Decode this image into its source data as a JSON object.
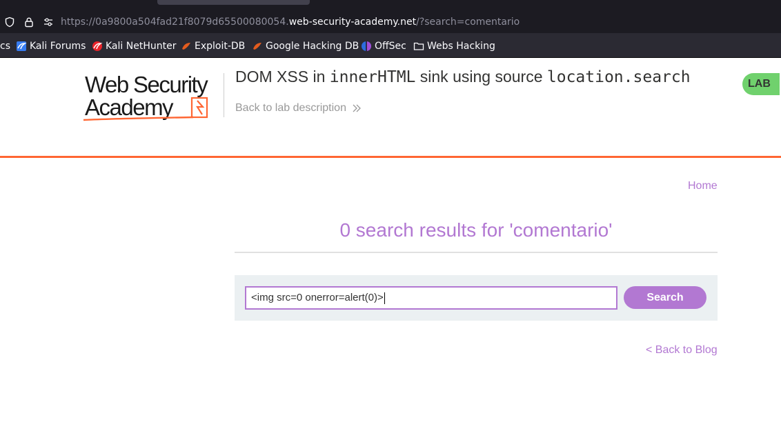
{
  "browser": {
    "url_prefix": "https://0a9800a504fad21f8079d65500080054.",
    "url_host": "web-security-academy.net",
    "url_suffix": "/?search=comentario",
    "bookmarks": [
      {
        "label": "cs",
        "icon": "truncated-icon"
      },
      {
        "label": "Kali Forums",
        "icon": "kali-forums-icon"
      },
      {
        "label": "Kali NetHunter",
        "icon": "kali-nethunter-icon"
      },
      {
        "label": "Exploit-DB",
        "icon": "exploit-db-icon"
      },
      {
        "label": "Google Hacking DB",
        "icon": "google-hacking-db-icon"
      },
      {
        "label": "OffSec",
        "icon": "offsec-icon"
      },
      {
        "label": "Webs Hacking",
        "icon": "folder-icon"
      }
    ]
  },
  "header": {
    "logo_text": "Web Security Academy",
    "title_prefix": "DOM XSS in ",
    "title_code1": "innerHTML",
    "title_middle": " sink using source ",
    "title_code2": "location.search",
    "back_to_lab": "Back to lab description",
    "lab_badge": "LAB"
  },
  "nav": {
    "home": "Home"
  },
  "results": {
    "title": "0 search results for 'comentario'"
  },
  "search": {
    "value": "<img src=0 onerror=alert(0)>",
    "button": "Search"
  },
  "footer": {
    "back_to_blog": "< Back to Blog"
  },
  "colors": {
    "accent": "#b278d2",
    "orange": "#ff6633",
    "lab_green": "#70d16d"
  }
}
